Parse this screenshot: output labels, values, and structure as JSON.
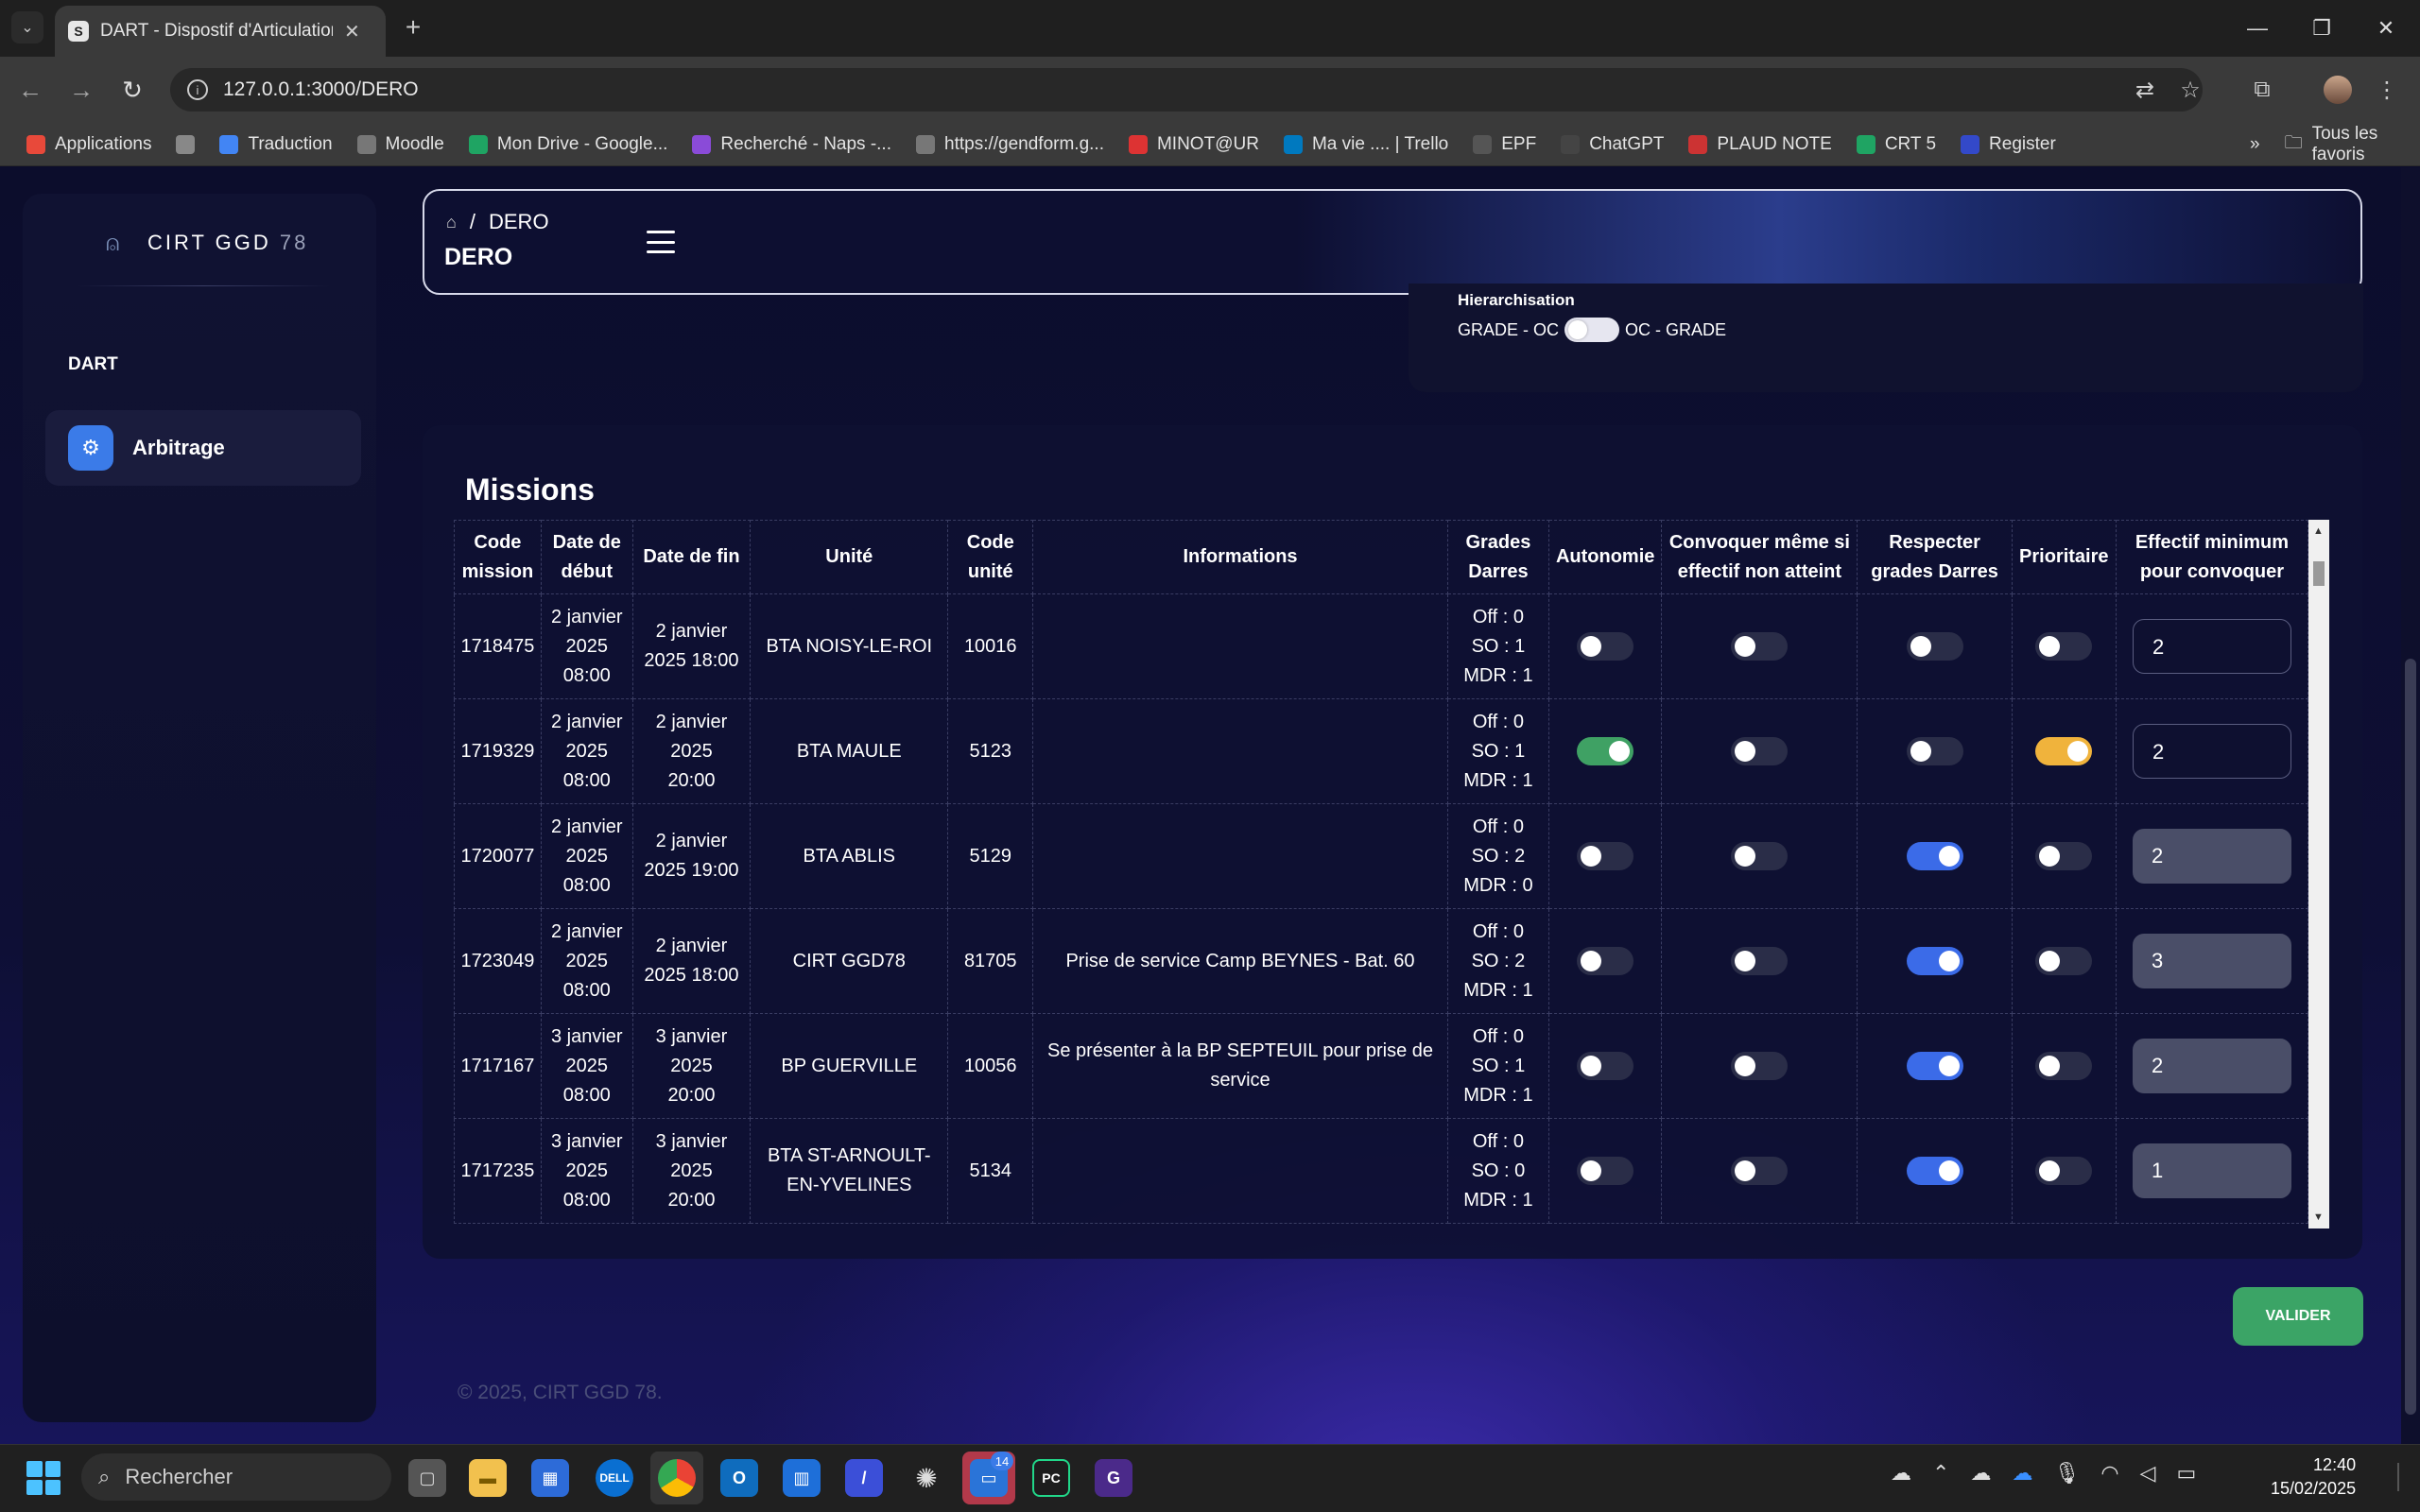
{
  "browser": {
    "tab_title": "DART - Dispostif d'Articulation de",
    "tab_favicon": "S",
    "url": "127.0.0.1:3000/DERO",
    "bookmarks": [
      {
        "label": "Applications",
        "icon": "apps-grid-icon",
        "color": "#e8493a"
      },
      {
        "label": "",
        "icon": "grid-icon",
        "color": "#888888"
      },
      {
        "label": "Traduction",
        "icon": "translate-icon",
        "color": "#4285f4"
      },
      {
        "label": "Moodle",
        "icon": "globe-icon",
        "color": "#777777"
      },
      {
        "label": "Mon Drive - Google...",
        "icon": "drive-icon",
        "color": "#1fa463"
      },
      {
        "label": "Recherché - Naps -...",
        "icon": "heart-icon",
        "color": "#8a4bd8"
      },
      {
        "label": "https://gendform.g...",
        "icon": "globe-icon",
        "color": "#777777"
      },
      {
        "label": "MINOT@UR",
        "icon": "minotaur-icon",
        "color": "#d33"
      },
      {
        "label": "Ma vie .... | Trello",
        "icon": "trello-icon",
        "color": "#0079bf"
      },
      {
        "label": "EPF",
        "icon": "folder-icon",
        "color": "#555555"
      },
      {
        "label": "ChatGPT",
        "icon": "chatgpt-icon",
        "color": "#444444"
      },
      {
        "label": "PLAUD NOTE",
        "icon": "plaud-icon",
        "color": "#c33"
      },
      {
        "label": "CRT 5",
        "icon": "drive-icon",
        "color": "#1fa463"
      },
      {
        "label": "Register",
        "icon": "e4-icon",
        "color": "#3349c9"
      }
    ],
    "all_bookmarks": "Tous les favoris"
  },
  "sidebar": {
    "brand": "CIRT GGD",
    "brand_num": "78",
    "section": "DART",
    "nav_item": "Arbitrage"
  },
  "header": {
    "crumb": "DERO",
    "title": "DERO"
  },
  "hierarchisation": {
    "label": "Hierarchisation",
    "left": "GRADE - OC",
    "right": "OC - GRADE"
  },
  "missions": {
    "title": "Missions",
    "columns": [
      "Code mission",
      "Date de début",
      "Date de fin",
      "Unité",
      "Code unité",
      "Informations",
      "Grades Darres",
      "Autonomie",
      "Convoquer même si effectif non atteint",
      "Respecter grades Darres",
      "Prioritaire",
      "Effectif minimum pour convoquer"
    ],
    "rows": [
      {
        "code": "1718475",
        "debut": [
          "2 janvier",
          "2025",
          "08:00"
        ],
        "fin": [
          "2 janvier",
          "2025 18:00"
        ],
        "unite": "BTA NOISY-LE-ROI",
        "code_unite": "10016",
        "info": "",
        "grades": [
          "Off : 0",
          "SO : 1",
          "MDR : 1"
        ],
        "autonomie": false,
        "convoquer": false,
        "respecter": false,
        "prioritaire": false,
        "effectif": "2",
        "eff_style": "dark"
      },
      {
        "code": "1719329",
        "debut": [
          "2 janvier",
          "2025",
          "08:00"
        ],
        "fin": [
          "2 janvier",
          "2025",
          "20:00"
        ],
        "unite": "BTA MAULE",
        "code_unite": "5123",
        "info": "",
        "grades": [
          "Off : 0",
          "SO : 1",
          "MDR : 1"
        ],
        "autonomie": true,
        "convoquer": false,
        "respecter": false,
        "prioritaire": true,
        "effectif": "2",
        "eff_style": "dark"
      },
      {
        "code": "1720077",
        "debut": [
          "2 janvier",
          "2025",
          "08:00"
        ],
        "fin": [
          "2 janvier",
          "2025 19:00"
        ],
        "unite": "BTA ABLIS",
        "code_unite": "5129",
        "info": "",
        "grades": [
          "Off : 0",
          "SO : 2",
          "MDR : 0"
        ],
        "autonomie": false,
        "convoquer": false,
        "respecter": true,
        "prioritaire": false,
        "effectif": "2",
        "eff_style": "grey"
      },
      {
        "code": "1723049",
        "debut": [
          "2 janvier",
          "2025",
          "08:00"
        ],
        "fin": [
          "2 janvier",
          "2025 18:00"
        ],
        "unite": "CIRT GGD78",
        "code_unite": "81705",
        "info": "Prise de service Camp BEYNES - Bat. 60",
        "grades": [
          "Off : 0",
          "SO : 2",
          "MDR : 1"
        ],
        "autonomie": false,
        "convoquer": false,
        "respecter": true,
        "prioritaire": false,
        "effectif": "3",
        "eff_style": "grey"
      },
      {
        "code": "1717167",
        "debut": [
          "3 janvier",
          "2025",
          "08:00"
        ],
        "fin": [
          "3 janvier",
          "2025",
          "20:00"
        ],
        "unite": "BP GUERVILLE",
        "code_unite": "10056",
        "info": "Se présenter à la BP SEPTEUIL pour prise de service",
        "grades": [
          "Off : 0",
          "SO : 1",
          "MDR : 1"
        ],
        "autonomie": false,
        "convoquer": false,
        "respecter": true,
        "prioritaire": false,
        "effectif": "2",
        "eff_style": "grey"
      },
      {
        "code": "1717235",
        "debut": [
          "3 janvier",
          "2025",
          "08:00"
        ],
        "fin": [
          "3 janvier",
          "2025",
          "20:00"
        ],
        "unite": "BTA ST-ARNOULT-EN-YVELINES",
        "code_unite": "5134",
        "info": "",
        "grades": [
          "Off : 0",
          "SO : 0",
          "MDR : 1"
        ],
        "autonomie": false,
        "convoquer": false,
        "respecter": true,
        "prioritaire": false,
        "effectif": "1",
        "eff_style": "grey"
      }
    ],
    "submit": "VALIDER"
  },
  "footer": "© 2025, CIRT GGD 78.",
  "taskbar": {
    "search_placeholder": "Rechercher",
    "time": "12:40",
    "date": "15/02/2025",
    "badge": "14"
  },
  "colors": {
    "accent_blue": "#3b6be8",
    "toggle_green": "#3fa164",
    "toggle_yellow": "#f0b33c",
    "valider": "#3ba466"
  }
}
